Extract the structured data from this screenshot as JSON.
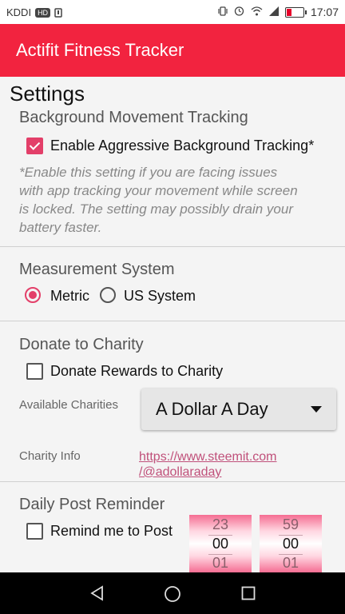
{
  "status_bar": {
    "carrier": "KDDI",
    "hd_badge": "HD",
    "time": "17:07",
    "icons": [
      "vibrate-icon",
      "alarm-icon",
      "wifi-icon",
      "signal-icon",
      "battery-icon"
    ]
  },
  "app_bar": {
    "title": "Actifit Fitness Tracker"
  },
  "page": {
    "title": "Settings"
  },
  "background_tracking": {
    "heading": "Background Movement Tracking",
    "checkbox_label": "Enable Aggressive Background Tracking*",
    "checked": true,
    "note_lines": [
      "*Enable this setting if you are facing issues",
      "with app tracking your movement while screen",
      "is locked. The setting may possibly drain your",
      "battery faster."
    ]
  },
  "measurement": {
    "heading": "Measurement System",
    "options": [
      {
        "label": "Metric",
        "selected": true
      },
      {
        "label": "US System",
        "selected": false
      }
    ]
  },
  "charity": {
    "heading": "Donate to Charity",
    "checkbox_label": "Donate Rewards to Charity",
    "checked": false,
    "available_label": "Available Charities",
    "selected_charity": "A Dollar A Day",
    "info_label": "Charity Info",
    "info_link_line1": "https://www.steemit.com",
    "info_link_line2": "/@adollaraday"
  },
  "reminder": {
    "heading": "Daily Post Reminder",
    "checkbox_label": "Remind me to Post",
    "checked": false,
    "hour": {
      "prev": "23",
      "current": "00",
      "next": "01"
    },
    "minute": {
      "prev": "59",
      "current": "00",
      "next": "01"
    }
  },
  "colors": {
    "accent": "#f2233f",
    "checkbox": "#e33f69",
    "link": "#c0507a"
  }
}
